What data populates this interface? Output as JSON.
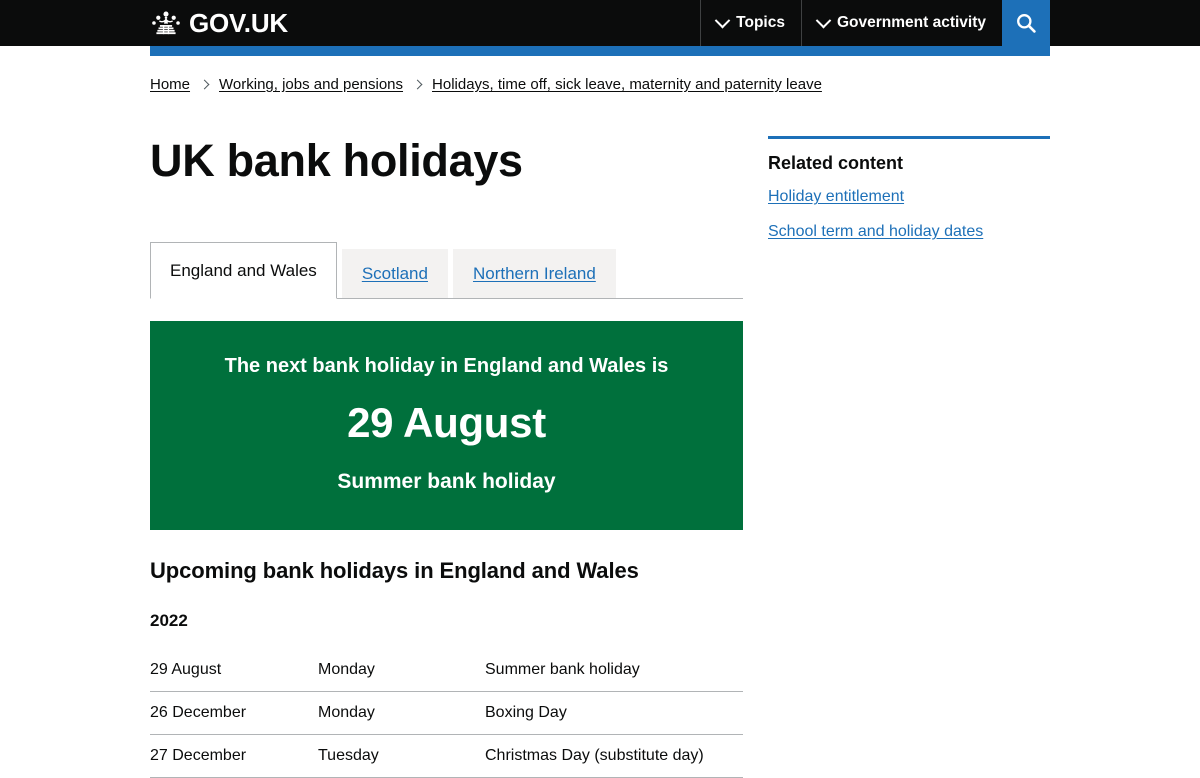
{
  "header": {
    "logo_text": "GOV.UK",
    "logo_icon": "crown-icon",
    "nav": [
      {
        "label": "Topics",
        "icon": "chevron-down-icon"
      },
      {
        "label": "Government activity",
        "icon": "chevron-down-icon"
      }
    ],
    "search_icon": "search-icon",
    "accent_color": "#1d70b8"
  },
  "breadcrumbs": [
    {
      "label": "Home"
    },
    {
      "label": "Working, jobs and pensions"
    },
    {
      "label": "Holidays, time off, sick leave, maternity and paternity leave"
    }
  ],
  "page": {
    "title": "UK bank holidays"
  },
  "tabs": [
    {
      "label": "England and Wales",
      "selected": true
    },
    {
      "label": "Scotland",
      "selected": false
    },
    {
      "label": "Northern Ireland",
      "selected": false
    }
  ],
  "callout": {
    "lead": "The next bank holiday in England and Wales is",
    "date": "29 August",
    "name": "Summer bank holiday",
    "background_color": "#00703c"
  },
  "section": {
    "heading": "Upcoming bank holidays in England and Wales",
    "year": "2022"
  },
  "table": {
    "rows": [
      {
        "date": "29 August",
        "day": "Monday",
        "name": "Summer bank holiday"
      },
      {
        "date": "26 December",
        "day": "Monday",
        "name": "Boxing Day"
      },
      {
        "date": "27 December",
        "day": "Tuesday",
        "name": "Christmas Day (substitute day)"
      }
    ]
  },
  "sidebar": {
    "heading": "Related content",
    "links": [
      {
        "label": "Holiday entitlement"
      },
      {
        "label": "School term and holiday dates"
      }
    ],
    "rule_color": "#1d70b8"
  }
}
